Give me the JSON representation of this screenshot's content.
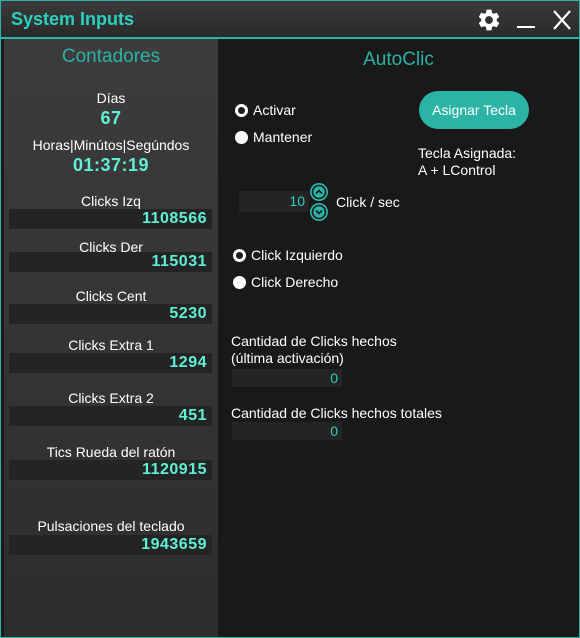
{
  "window": {
    "title": "System Inputs"
  },
  "icons": {
    "settings": "gear-icon",
    "minimize": "minimize-icon",
    "close": "close-icon"
  },
  "colors": {
    "accent": "#2bb3a5",
    "value_text": "#5ff0d6",
    "window_bg": "#1b1b1b"
  },
  "counters": {
    "title": "Contadores",
    "days_label": "Días",
    "days_value": "67",
    "time_label": "Horas|Minútos|Segúndos",
    "time_value": "01:37:19",
    "clicks_left_label": "Clicks Izq",
    "clicks_left_value": "1108566",
    "clicks_right_label": "Clicks Der",
    "clicks_right_value": "115031",
    "clicks_center_label": "Clicks Cent",
    "clicks_center_value": "5230",
    "clicks_extra1_label": "Clicks Extra 1",
    "clicks_extra1_value": "1294",
    "clicks_extra2_label": "Clicks Extra 2",
    "clicks_extra2_value": "451",
    "wheel_label": "Tics Rueda del ratón",
    "wheel_value": "1120915",
    "keyboard_label": "Pulsaciones del teclado",
    "keyboard_value": "1943659"
  },
  "autoclic": {
    "title": "AutoClic",
    "mode_activate": "Activar",
    "mode_hold": "Mantener",
    "assign_button": "Asignar Tecla",
    "assigned_key_label": "Tecla Asignada:",
    "assigned_key_value": "A + LControl",
    "rate_value": "10",
    "rate_unit": "Click / sec",
    "left_click": "Click Izquierdo",
    "right_click": "Click Derecho",
    "last_count_label_1": "Cantidad de Clicks hechos",
    "last_count_label_2": "(última activación)",
    "last_count_value": "0",
    "total_count_label": "Cantidad de Clicks hechos totales",
    "total_count_value": "0"
  }
}
